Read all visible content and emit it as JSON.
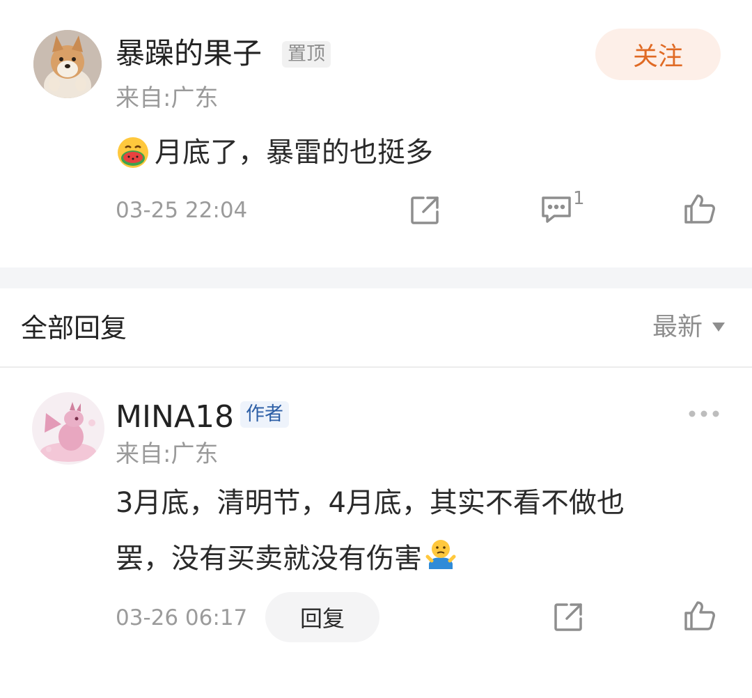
{
  "top_comment": {
    "username": "暴躁的果子",
    "pinned_tag": "置顶",
    "location": "来自:广东",
    "follow_label": "关注",
    "content": "月底了，暴雷的也挺多",
    "time": "03-25 22:04",
    "comment_count": "1"
  },
  "replies_header": {
    "title": "全部回复",
    "sort_label": "最新"
  },
  "reply": {
    "username": "MINA18",
    "author_tag": "作者",
    "location": "来自:广东",
    "content_line1": "3月底，清明节，4月底，其实不看不做也",
    "content_line2": "罢，没有买卖就没有伤害",
    "time": "03-26 06:17",
    "reply_label": "回复"
  },
  "colors": {
    "accent_orange": "#e06a24",
    "follow_bg": "#fdefe8",
    "author_tag_blue": "#2d5fa6"
  },
  "icons": [
    "share-icon",
    "comment-icon",
    "thumbs-up-icon",
    "more-icon",
    "sort-caret-icon",
    "watermelon-emoji-icon",
    "shrug-emoji-icon"
  ]
}
